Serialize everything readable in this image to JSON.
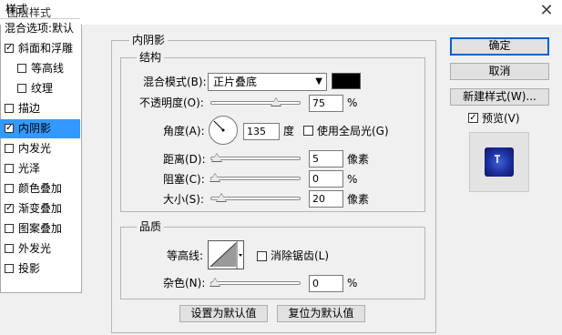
{
  "window": {
    "title": "图层样式",
    "close_glyph": "✕"
  },
  "sidebar": {
    "header": "样式",
    "items": [
      {
        "label": "混合选项:默认",
        "checkbox": false,
        "checked": false
      },
      {
        "label": "斜面和浮雕",
        "checkbox": true,
        "checked": true
      },
      {
        "label": "等高线",
        "checkbox": true,
        "checked": false
      },
      {
        "label": "纹理",
        "checkbox": true,
        "checked": false
      },
      {
        "label": "描边",
        "checkbox": true,
        "checked": false
      },
      {
        "label": "内阴影",
        "checkbox": true,
        "checked": true,
        "selected": true
      },
      {
        "label": "内发光",
        "checkbox": true,
        "checked": false
      },
      {
        "label": "光泽",
        "checkbox": true,
        "checked": false
      },
      {
        "label": "颜色叠加",
        "checkbox": true,
        "checked": false
      },
      {
        "label": "渐变叠加",
        "checkbox": true,
        "checked": true
      },
      {
        "label": "图案叠加",
        "checkbox": true,
        "checked": false
      },
      {
        "label": "外发光",
        "checkbox": true,
        "checked": false
      },
      {
        "label": "投影",
        "checkbox": true,
        "checked": false
      }
    ]
  },
  "inner_shadow": {
    "section_title": "内阴影",
    "structure": {
      "title": "结构",
      "blend_mode_label": "混合模式(B):",
      "blend_mode_value": "正片叠底",
      "blend_color": "#000000",
      "opacity_label": "不透明度(O):",
      "opacity_value": "75",
      "opacity_unit": "%",
      "opacity_fraction": 0.75,
      "angle_label": "角度(A):",
      "angle_value": "135",
      "angle_unit": "度",
      "global_light_label": "使用全局光(G)",
      "global_light_checked": false,
      "distance_label": "距离(D):",
      "distance_value": "5",
      "distance_unit": "像素",
      "distance_fraction": 0.02,
      "choke_label": "阻塞(C):",
      "choke_value": "0",
      "choke_unit": "%",
      "choke_fraction": 0.0,
      "size_label": "大小(S):",
      "size_value": "20",
      "size_unit": "像素",
      "size_fraction": 0.08
    },
    "quality": {
      "title": "品质",
      "contour_label": "等高线:",
      "anti_alias_label": "消除锯齿(L)",
      "anti_alias_checked": false,
      "noise_label": "杂色(N):",
      "noise_value": "0",
      "noise_unit": "%",
      "noise_fraction": 0.0
    },
    "make_default_label": "设置为默认值",
    "reset_default_label": "复位为默认值"
  },
  "actions": {
    "ok_label": "确定",
    "cancel_label": "取消",
    "new_style_label": "新建样式(W)...",
    "preview_label": "预览(V)",
    "preview_checked": true
  }
}
